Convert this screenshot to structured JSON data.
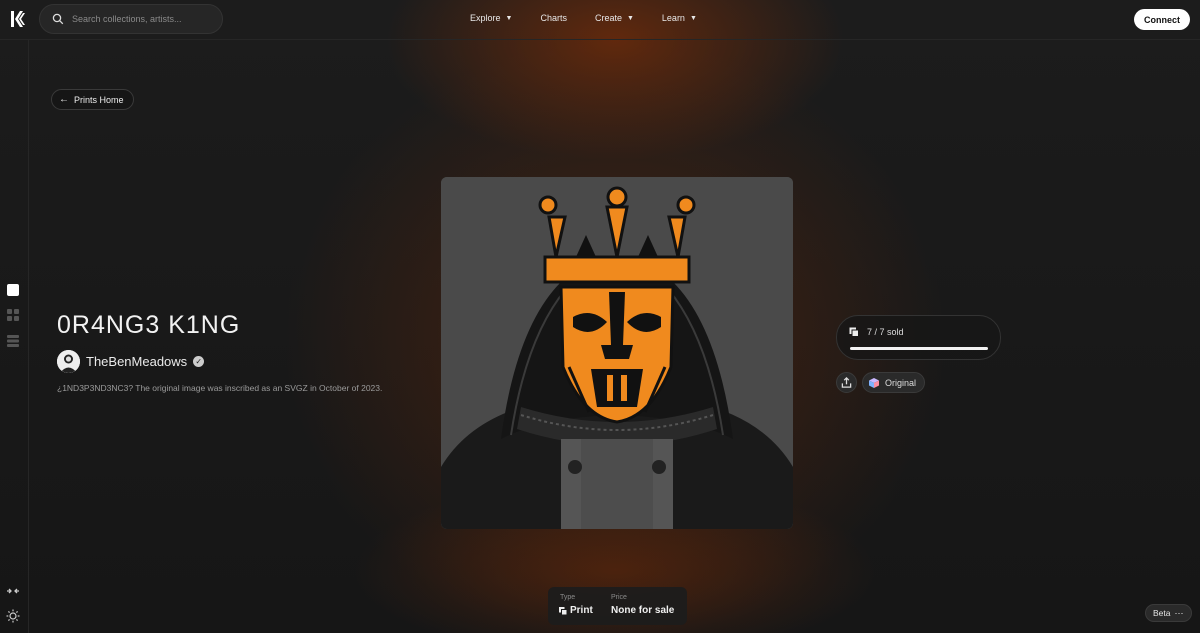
{
  "nav": {
    "search_placeholder": "Search collections, artists...",
    "items": [
      {
        "label": "Explore",
        "dropdown": true
      },
      {
        "label": "Charts",
        "dropdown": false
      },
      {
        "label": "Create",
        "dropdown": true
      },
      {
        "label": "Learn",
        "dropdown": true
      }
    ],
    "connect_label": "Connect"
  },
  "back": {
    "label": "Prints Home"
  },
  "item": {
    "title": "0R4NG3 K1NG",
    "artist": "TheBenMeadows",
    "description": "¿1ND3P3ND3NC3? The original image was inscribed as an SVGZ in October of 2023."
  },
  "sales": {
    "sold_text": "7 / 7 sold",
    "sold_fraction": 1.0
  },
  "badges": {
    "original_label": "Original"
  },
  "info": {
    "type_label": "Type",
    "type_value": "Print",
    "price_label": "Price",
    "price_value": "None for sale"
  },
  "footer": {
    "beta_label": "Beta"
  },
  "colors": {
    "accent": "#f08a1e",
    "background": "#151515",
    "art_bg": "#4a4a4a"
  }
}
